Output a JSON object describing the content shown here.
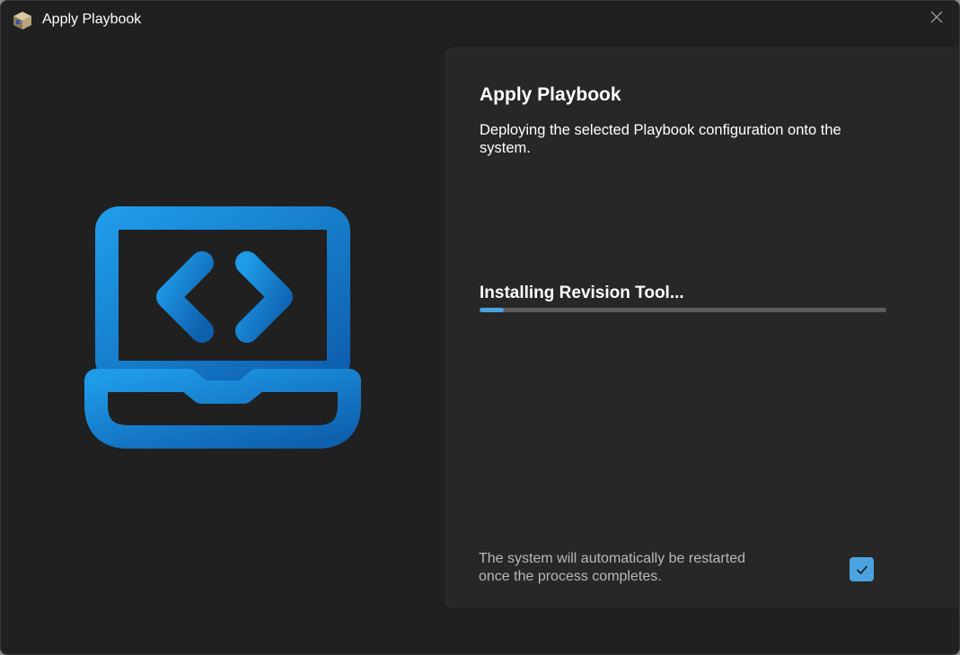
{
  "window": {
    "title": "Apply Playbook",
    "app_icon": "cube-app-icon",
    "close_icon": "close-icon"
  },
  "illustration": {
    "icon": "laptop-code-icon",
    "color": "#1a7fd0"
  },
  "panel": {
    "title": "Apply Playbook",
    "description": "Deploying the selected Playbook configuration onto the system.",
    "status": "Installing Revision Tool...",
    "progress": 0.06,
    "restart_note": "The system will automatically be restarted once the process completes.",
    "restart_checked": true
  },
  "colors": {
    "background": "#202020",
    "panel": "#272727",
    "accent": "#4aa3df",
    "track": "#5c5c5c"
  }
}
